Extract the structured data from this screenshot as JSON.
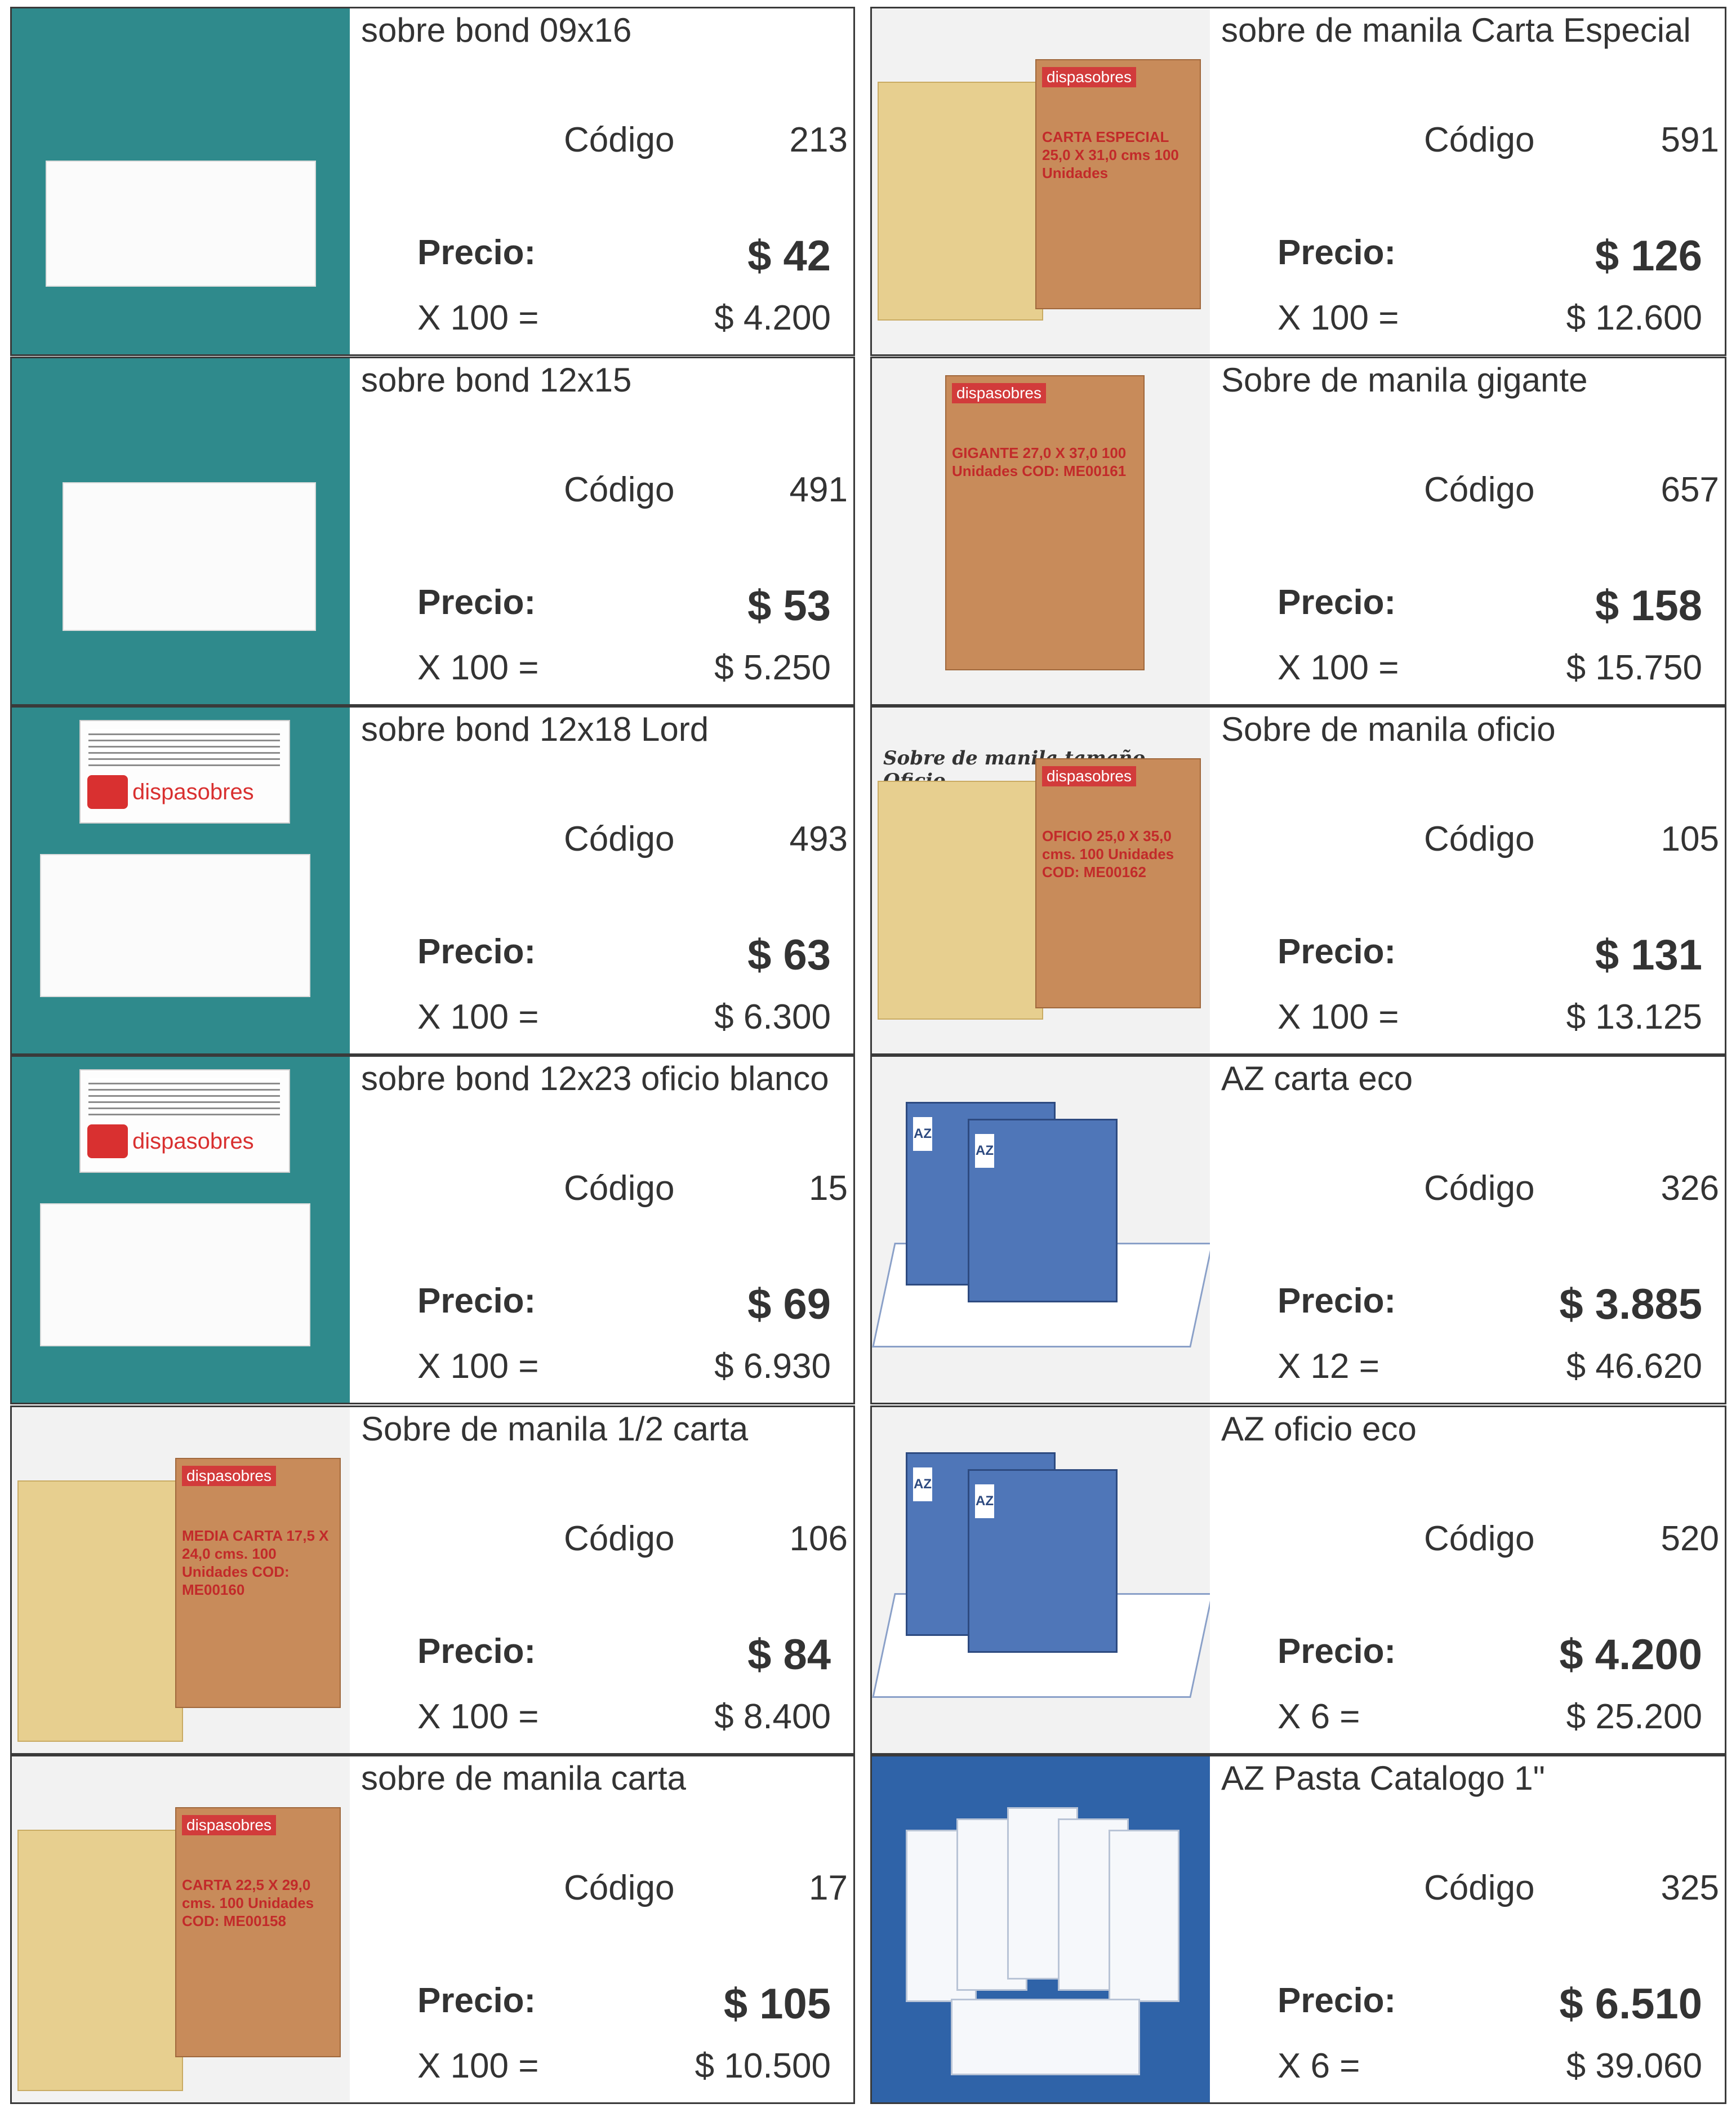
{
  "labels": {
    "codigo": "Código",
    "precio": "Precio:"
  },
  "colors": {
    "teal_background": "#2f8a8c",
    "manila": "#e7cf8f",
    "box_brown": "#c88b5a",
    "brand_red": "#d93030",
    "binder_blue": "#4f76b8"
  },
  "products": [
    {
      "title": "sobre bond 09x16",
      "code": "213",
      "price": "$ 42",
      "qty": "X 100 =",
      "total": "$ 4.200",
      "image": {
        "kind": "bond-envelope"
      }
    },
    {
      "title": "sobre de manila Carta Especial",
      "code": "591",
      "price": "$ 126",
      "qty": "X 100 =",
      "total": "$ 12.600",
      "image": {
        "kind": "manila-with-box",
        "box_brand": "dispasobres",
        "box_text": "CARTA ESPECIAL 25,0 X 31,0 cms 100 Unidades"
      }
    },
    {
      "title": "sobre bond 12x15",
      "code": "491",
      "price": "$ 53",
      "qty": "X 100 =",
      "total": "$ 5.250",
      "image": {
        "kind": "bond-envelope"
      }
    },
    {
      "title": "Sobre de manila gigante",
      "code": "657",
      "price": "$ 158",
      "qty": "X 100 =",
      "total": "$ 15.750",
      "image": {
        "kind": "manila-box-gigante",
        "box_brand": "dispasobres",
        "box_text": "GIGANTE 27,0 X 37,0 100 Unidades COD: ME00161"
      }
    },
    {
      "title": "sobre bond 12x18 Lord",
      "code": "493",
      "price": "$ 63",
      "qty": "X 100 =",
      "total": "$ 6.300",
      "image": {
        "kind": "bond-envelope-label",
        "brand": "dispasobres"
      }
    },
    {
      "title": "Sobre de manila oficio",
      "code": "105",
      "price": "$ 131",
      "qty": "X 100 =",
      "total": "$ 13.125",
      "image": {
        "kind": "manila-with-box",
        "caption": "Sobre de manila tamaño Oficio",
        "box_brand": "dispasobres",
        "box_text": "OFICIO 25,0 X 35,0 cms. 100 Unidades COD: ME00162"
      }
    },
    {
      "title": "sobre bond 12x23 oficio blanco",
      "code": "15",
      "price": "$ 69",
      "qty": "X 100 =",
      "total": "$ 6.930",
      "image": {
        "kind": "bond-envelope-label",
        "brand": "dispasobres"
      }
    },
    {
      "title": "AZ carta eco",
      "code": "326",
      "price": "$ 3.885",
      "qty": "X 12 =",
      "total": "$ 46.620",
      "image": {
        "kind": "az-binders",
        "spine": "AZ"
      }
    },
    {
      "title": "Sobre de manila 1/2 carta",
      "code": "106",
      "price": "$ 84",
      "qty": "X 100 =",
      "total": "$ 8.400",
      "image": {
        "kind": "manila-with-box",
        "box_brand": "dispasobres",
        "box_text": "MEDIA CARTA 17,5 X 24,0 cms. 100 Unidades COD: ME00160"
      }
    },
    {
      "title": "AZ oficio eco",
      "code": "520",
      "price": "$ 4.200",
      "qty": "X 6 =",
      "total": "$ 25.200",
      "image": {
        "kind": "az-binders",
        "spine": "AZ"
      }
    },
    {
      "title": "sobre de manila carta",
      "code": "17",
      "price": "$ 105",
      "qty": "X 100 =",
      "total": "$ 10.500",
      "image": {
        "kind": "manila-with-box",
        "box_brand": "dispasobres",
        "box_text": "CARTA 22,5 X 29,0 cms. 100 Unidades COD: ME00158"
      }
    },
    {
      "title": "AZ Pasta Catalogo 1\"",
      "code": "325",
      "price": "$ 6.510",
      "qty": "X 6 =",
      "total": "$ 39.060",
      "image": {
        "kind": "catalog-binders"
      }
    }
  ]
}
